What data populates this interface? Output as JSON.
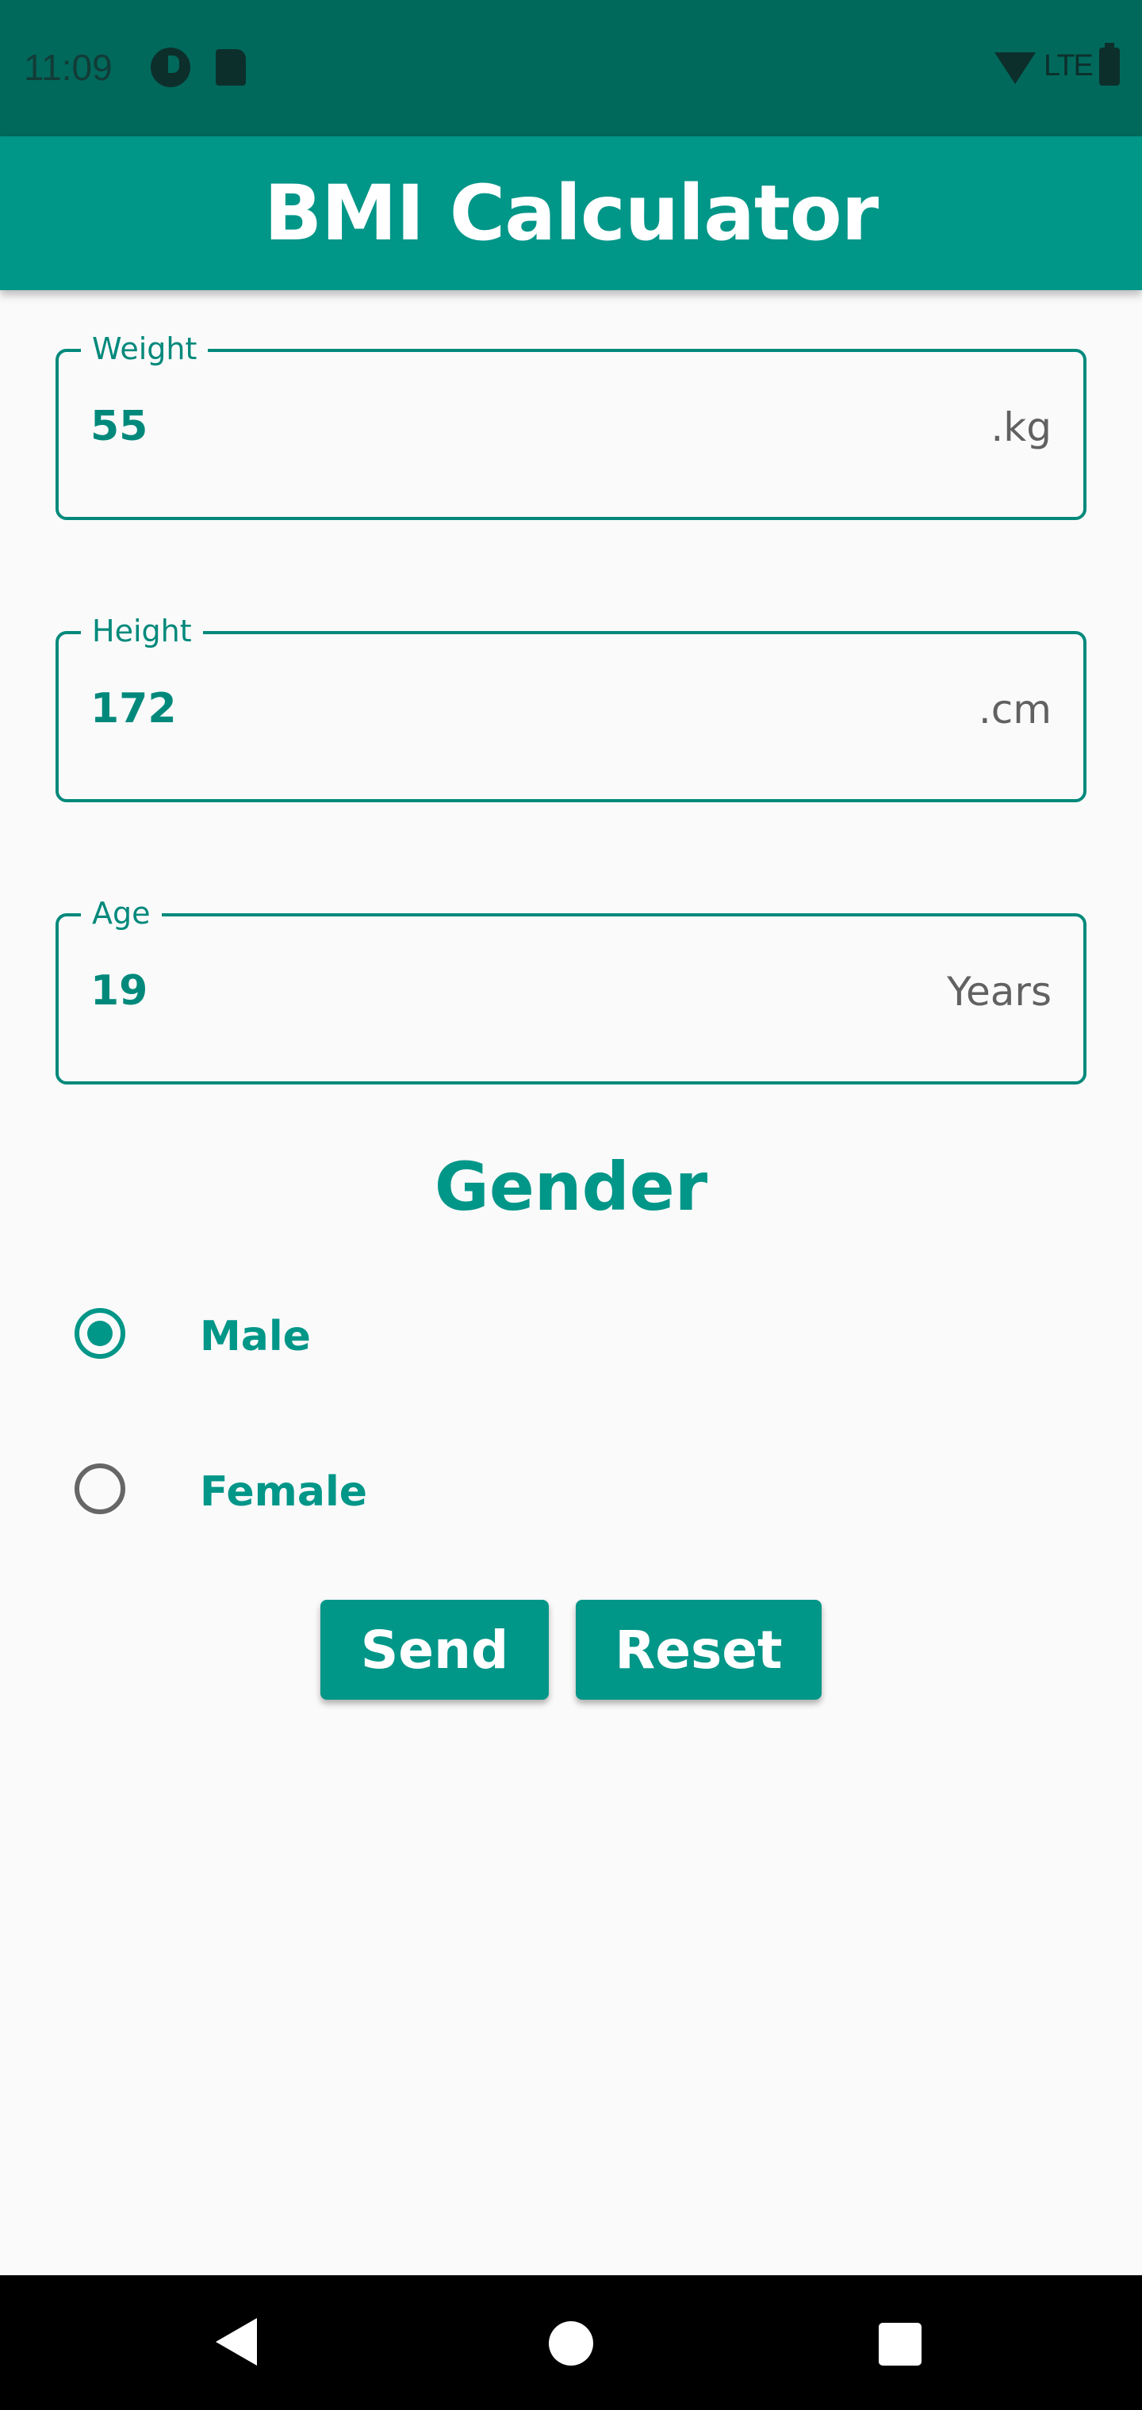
{
  "status_bar": {
    "time": "11:09",
    "network": "LTE",
    "icons": [
      "app-notification-icon",
      "sd-card-icon",
      "wifi-icon",
      "battery-icon"
    ]
  },
  "app_bar": {
    "title": "BMI Calculator"
  },
  "form": {
    "weight": {
      "label": "Weight",
      "value": "55",
      "suffix": ".kg"
    },
    "height": {
      "label": "Height",
      "value": "172",
      "suffix": ".cm"
    },
    "age": {
      "label": "Age",
      "value": "19",
      "suffix": "Years"
    }
  },
  "gender": {
    "title": "Gender",
    "options": [
      {
        "label": "Male",
        "checked": true
      },
      {
        "label": "Female",
        "checked": false
      }
    ]
  },
  "buttons": {
    "send": "Send",
    "reset": "Reset"
  },
  "nav_bar": {
    "icons": [
      "back-icon",
      "home-icon",
      "recents-icon"
    ]
  },
  "colors": {
    "primary": "#009688",
    "primary_dark": "#00695C",
    "background": "#FAFAFA"
  }
}
